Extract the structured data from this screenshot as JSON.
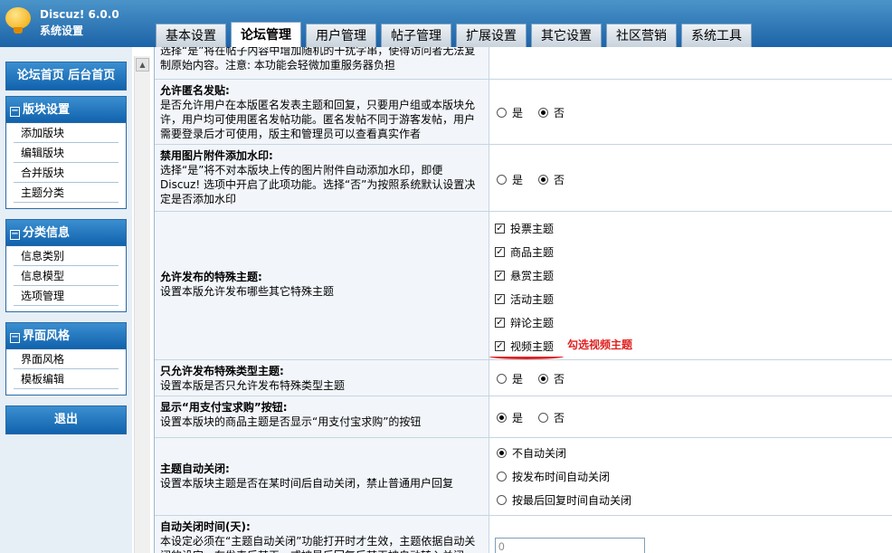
{
  "app": {
    "name": "Discuz! 6.0.0",
    "subtitle": "系统设置"
  },
  "tabs": [
    "基本设置",
    "论坛管理",
    "用户管理",
    "帖子管理",
    "扩展设置",
    "其它设置",
    "社区营销",
    "系统工具"
  ],
  "sidebar": {
    "top_link": "论坛首页  后台首页",
    "sections": [
      {
        "title": "版块设置",
        "items": [
          "添加版块",
          "编辑版块",
          "合并版块",
          "主题分类"
        ]
      },
      {
        "title": "分类信息",
        "items": [
          "信息类别",
          "信息模型",
          "选项管理"
        ]
      },
      {
        "title": "界面风格",
        "items": [
          "界面风格",
          "模板编辑"
        ]
      }
    ],
    "logout": "退出"
  },
  "settings": {
    "partial_top": {
      "desc1": "选择“是”将在帖子内容中增加随机的干扰字串，使得访问者无法复",
      "desc2": "制原始内容。注意: 本功能会轻微加重服务器负担"
    },
    "anonymous": {
      "title": "允许匿名发贴:",
      "desc": "是否允许用户在本版匿名发表主题和回复，只要用户组或本版块允许，用户均可使用匿名发帖功能。匿名发帖不同于游客发帖，用户需要登录后才可使用，版主和管理员可以查看真实作者",
      "yes": "是",
      "no": "否"
    },
    "watermark": {
      "title": "禁用图片附件添加水印:",
      "desc": "选择“是”将不对本版块上传的图片附件自动添加水印，即便 Discuz! 选项中开启了此项功能。选择“否”为按照系统默认设置决定是否添加水印",
      "yes": "是",
      "no": "否"
    },
    "special": {
      "title": "允许发布的特殊主题:",
      "desc": "设置本版允许发布哪些其它特殊主题",
      "options": [
        "投票主题",
        "商品主题",
        "悬赏主题",
        "活动主题",
        "辩论主题",
        "视频主题"
      ]
    },
    "special_only": {
      "title": "只允许发布特殊类型主题:",
      "desc": "设置本版是否只允许发布特殊类型主题",
      "yes": "是",
      "no": "否"
    },
    "alipay": {
      "title": "显示“用支付宝求购”按钮:",
      "desc": "设置本版块的商品主题是否显示“用支付宝求购”的按钮",
      "yes": "是",
      "no": "否"
    },
    "autoclose": {
      "title": "主题自动关闭:",
      "desc": "设置本版块主题是否在某时间后自动关闭，禁止普通用户回复",
      "options": [
        "不自动关闭",
        "按发布时间自动关闭",
        "按最后回复时间自动关闭"
      ]
    },
    "closetime": {
      "title": "自动关闭时间(天):",
      "desc": "本设定必须在“主题自动关闭”功能打开时才生效，主题依据自动关闭的设定，在发表后某天，或被最后回复后某天被自动转入关闭",
      "value": "0"
    }
  },
  "annotation": "勾选视频主题"
}
